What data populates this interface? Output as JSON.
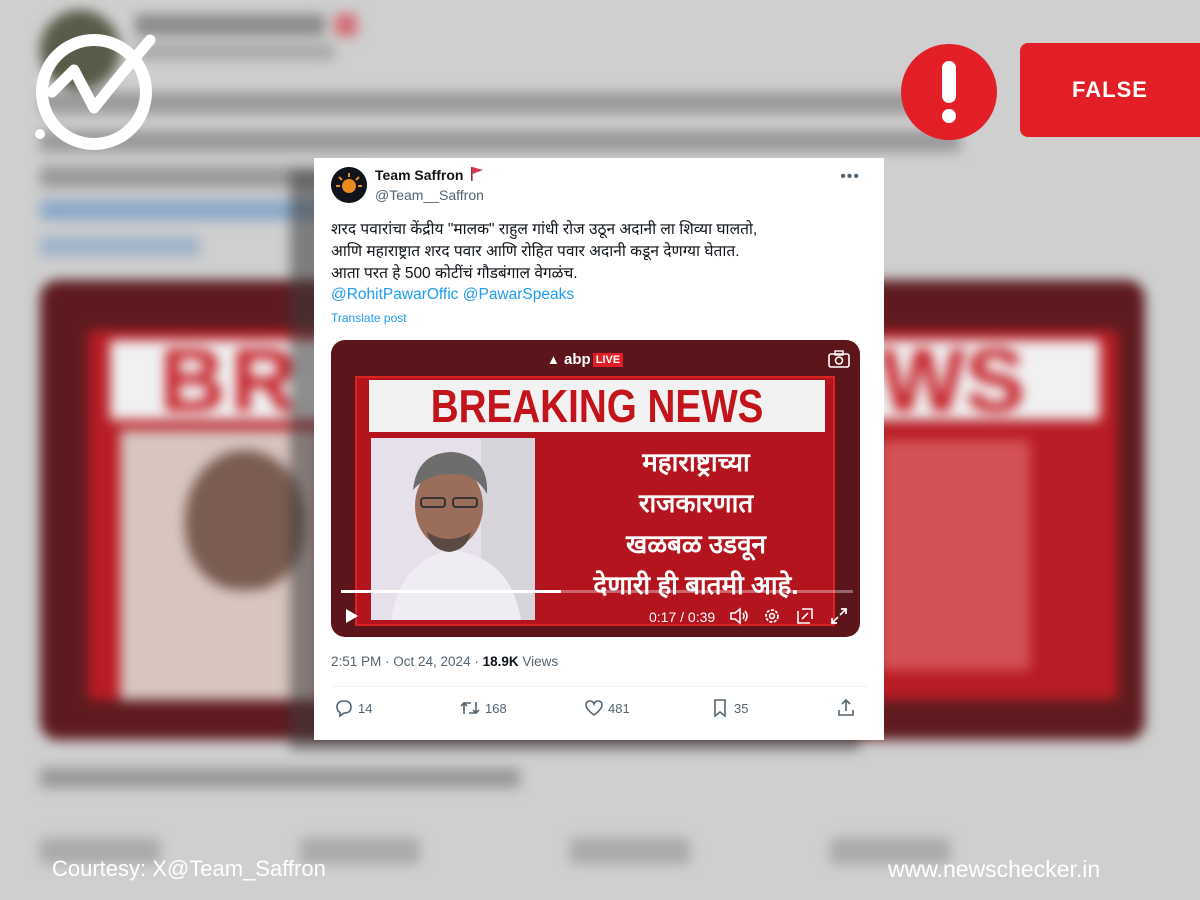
{
  "badge": {
    "verdict": "FALSE"
  },
  "footer": {
    "courtesy": "Courtesy: X@Team_Saffron",
    "site": "www.newschecker.in"
  },
  "tweet": {
    "name": "Team Saffron",
    "handle": "@Team__Saffron",
    "lines": [
      "शरद पवारांचा केंद्रीय \"मालक\" राहुल गांधी रोज उठून अदानी ला शिव्या घालतो,",
      "आणि महाराष्ट्रात शरद पवार आणि रोहित पवार अदानी कडून देणग्या घेतात.",
      "आता परत हे 500 कोटींचं गौडबंगाल वेगळंच."
    ],
    "mentions": "@RohitPawarOffic @PawarSpeaks",
    "translate": "Translate post",
    "video": {
      "channel": "abp",
      "live_label": "LIVE",
      "headline": "BREAKING NEWS",
      "body_lines": [
        "महाराष्ट्राच्या",
        "राजकारणात",
        "खळबळ उडवून",
        "देणारी ही बातमी आहे."
      ],
      "time": "0:17 / 0:39",
      "progress": 0.43
    },
    "timestamp": "2:51 PM · Oct 24, 2024 · ",
    "views_count": "18.9K",
    "views_label": " Views",
    "actions": {
      "replies": "14",
      "reposts": "168",
      "likes": "481",
      "bookmarks": "35"
    }
  }
}
